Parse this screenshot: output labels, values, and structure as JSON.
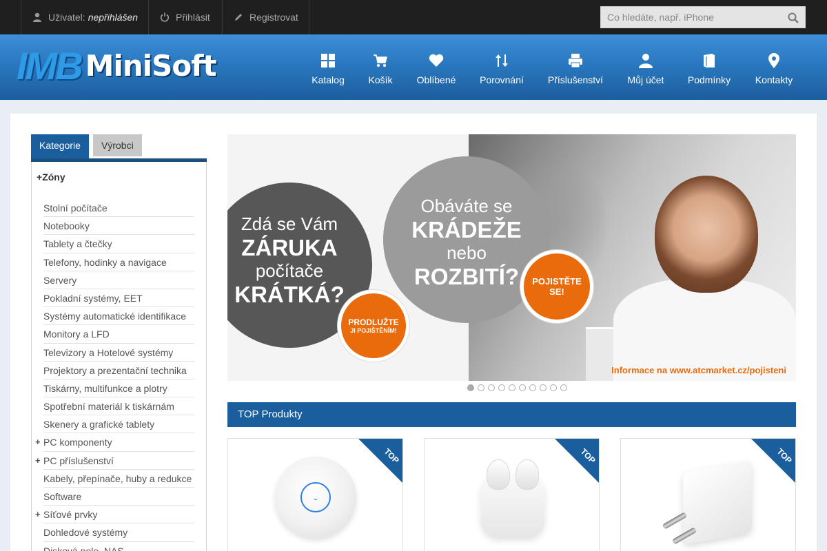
{
  "topbar": {
    "user_label": "Uživatel:",
    "user_status": "nepřihlášen",
    "login_label": "Přihlásit",
    "register_label": "Registrovat",
    "search_placeholder": "Co hledáte, např. iPhone"
  },
  "header": {
    "logo_part1": "IMB",
    "logo_part2": "MiniSoft",
    "nav": [
      {
        "label": "Katalog",
        "icon": "grid-icon"
      },
      {
        "label": "Košík",
        "icon": "cart-icon"
      },
      {
        "label": "Oblíbené",
        "icon": "heart-icon"
      },
      {
        "label": "Porovnání",
        "icon": "sort-arrows-icon"
      },
      {
        "label": "Příslušenství",
        "icon": "printer-icon"
      },
      {
        "label": "Můj účet",
        "icon": "user-icon"
      },
      {
        "label": "Podmínky",
        "icon": "book-icon"
      },
      {
        "label": "Kontakty",
        "icon": "map-pin-icon"
      }
    ]
  },
  "sidebar": {
    "tabs": [
      "Kategorie",
      "Výrobci"
    ],
    "zone_title": "Zóny",
    "categories": [
      {
        "label": "Stolní počítače",
        "expandable": false
      },
      {
        "label": "Notebooky",
        "expandable": false
      },
      {
        "label": "Tablety a čtečky",
        "expandable": false
      },
      {
        "label": "Telefony, hodinky a navigace",
        "expandable": false
      },
      {
        "label": "Servery",
        "expandable": false
      },
      {
        "label": "Pokladní systémy, EET",
        "expandable": false
      },
      {
        "label": "Systémy automatické identifikace",
        "expandable": false
      },
      {
        "label": "Monitory a LFD",
        "expandable": false
      },
      {
        "label": "Televizory a Hotelové systémy",
        "expandable": false
      },
      {
        "label": "Projektory a prezentační technika",
        "expandable": false
      },
      {
        "label": "Tiskárny, multifunkce a plotry",
        "expandable": false
      },
      {
        "label": "Spotřební materiál k tiskárnám",
        "expandable": false
      },
      {
        "label": "Skenery a grafické tablety",
        "expandable": false
      },
      {
        "label": "PC komponenty",
        "expandable": true
      },
      {
        "label": "PC příslušenství",
        "expandable": true
      },
      {
        "label": "Kabely, přepínače, huby a redukce",
        "expandable": false
      },
      {
        "label": "Software",
        "expandable": false
      },
      {
        "label": "Síťové prvky",
        "expandable": true
      },
      {
        "label": "Dohledové systémy",
        "expandable": false
      },
      {
        "label": "Disková pole, NAS",
        "expandable": false
      }
    ]
  },
  "banner": {
    "left_circle": [
      "Zdá se Vám",
      "ZÁRUKA",
      "počítače",
      "KRÁTKÁ?"
    ],
    "left_badge": [
      "PRODLUŽTE",
      "JI POJIŠTĚNÍM!"
    ],
    "right_circle": [
      "Obáváte se",
      "KRÁDEŽE",
      "nebo",
      "ROZBITÍ?"
    ],
    "right_badge": [
      "POJISTĚTE",
      "SE!"
    ],
    "info": "Informace na www.atcmarket.cz/pojisteni",
    "slides": 10,
    "active_slide": 1
  },
  "top_products": {
    "title": "TOP Produkty",
    "ribbon_label": "TOP",
    "items": [
      {
        "name": "access-point"
      },
      {
        "name": "earbuds"
      },
      {
        "name": "charger"
      }
    ]
  },
  "colors": {
    "accent": "#1b5e9e",
    "orange": "#ea6b0c",
    "topbar": "#1f1f1f"
  }
}
